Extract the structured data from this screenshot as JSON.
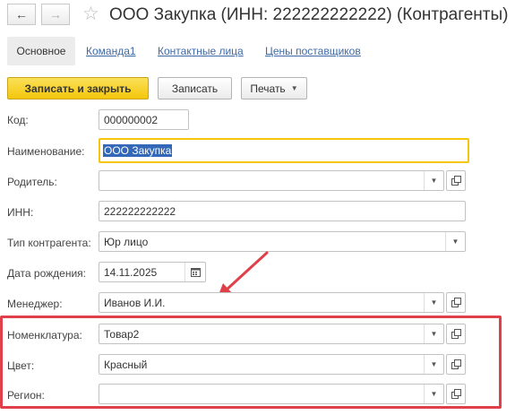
{
  "window": {
    "title": "ООО Закупка (ИНН: 222222222222) (Контрагенты)",
    "back_icon": "arrow-left",
    "forward_icon": "arrow-right",
    "favorite_icon": "star-outline"
  },
  "tabs": [
    {
      "label": "Основное",
      "active": true
    },
    {
      "label": "Команда1",
      "active": false
    },
    {
      "label": "Контактные лица",
      "active": false
    },
    {
      "label": "Цены поставщиков",
      "active": false
    }
  ],
  "toolbar": {
    "save_close_label": "Записать и закрыть",
    "save_label": "Записать",
    "print_label": "Печать"
  },
  "form": {
    "code": {
      "label": "Код:",
      "value": "000000002"
    },
    "name": {
      "label": "Наименование:",
      "value": "ООО Закупка"
    },
    "parent": {
      "label": "Родитель:",
      "value": ""
    },
    "inn": {
      "label": "ИНН:",
      "value": "222222222222"
    },
    "counterparty_type": {
      "label": "Тип контрагента:",
      "value": "Юр лицо"
    },
    "birth_date": {
      "label": "Дата рождения:",
      "value": "14.11.2025"
    },
    "manager": {
      "label": "Менеджер:",
      "value": "Иванов И.И."
    },
    "nomenclature": {
      "label": "Номенклатура:",
      "value": "Товар2"
    },
    "color": {
      "label": "Цвет:",
      "value": "Красный"
    },
    "region": {
      "label": "Регион:",
      "value": ""
    }
  },
  "colors": {
    "accent_yellow": "#f4c60c",
    "link_blue": "#3f69a4",
    "annotation_red": "#e0404a",
    "selection_blue": "#3367b8"
  }
}
